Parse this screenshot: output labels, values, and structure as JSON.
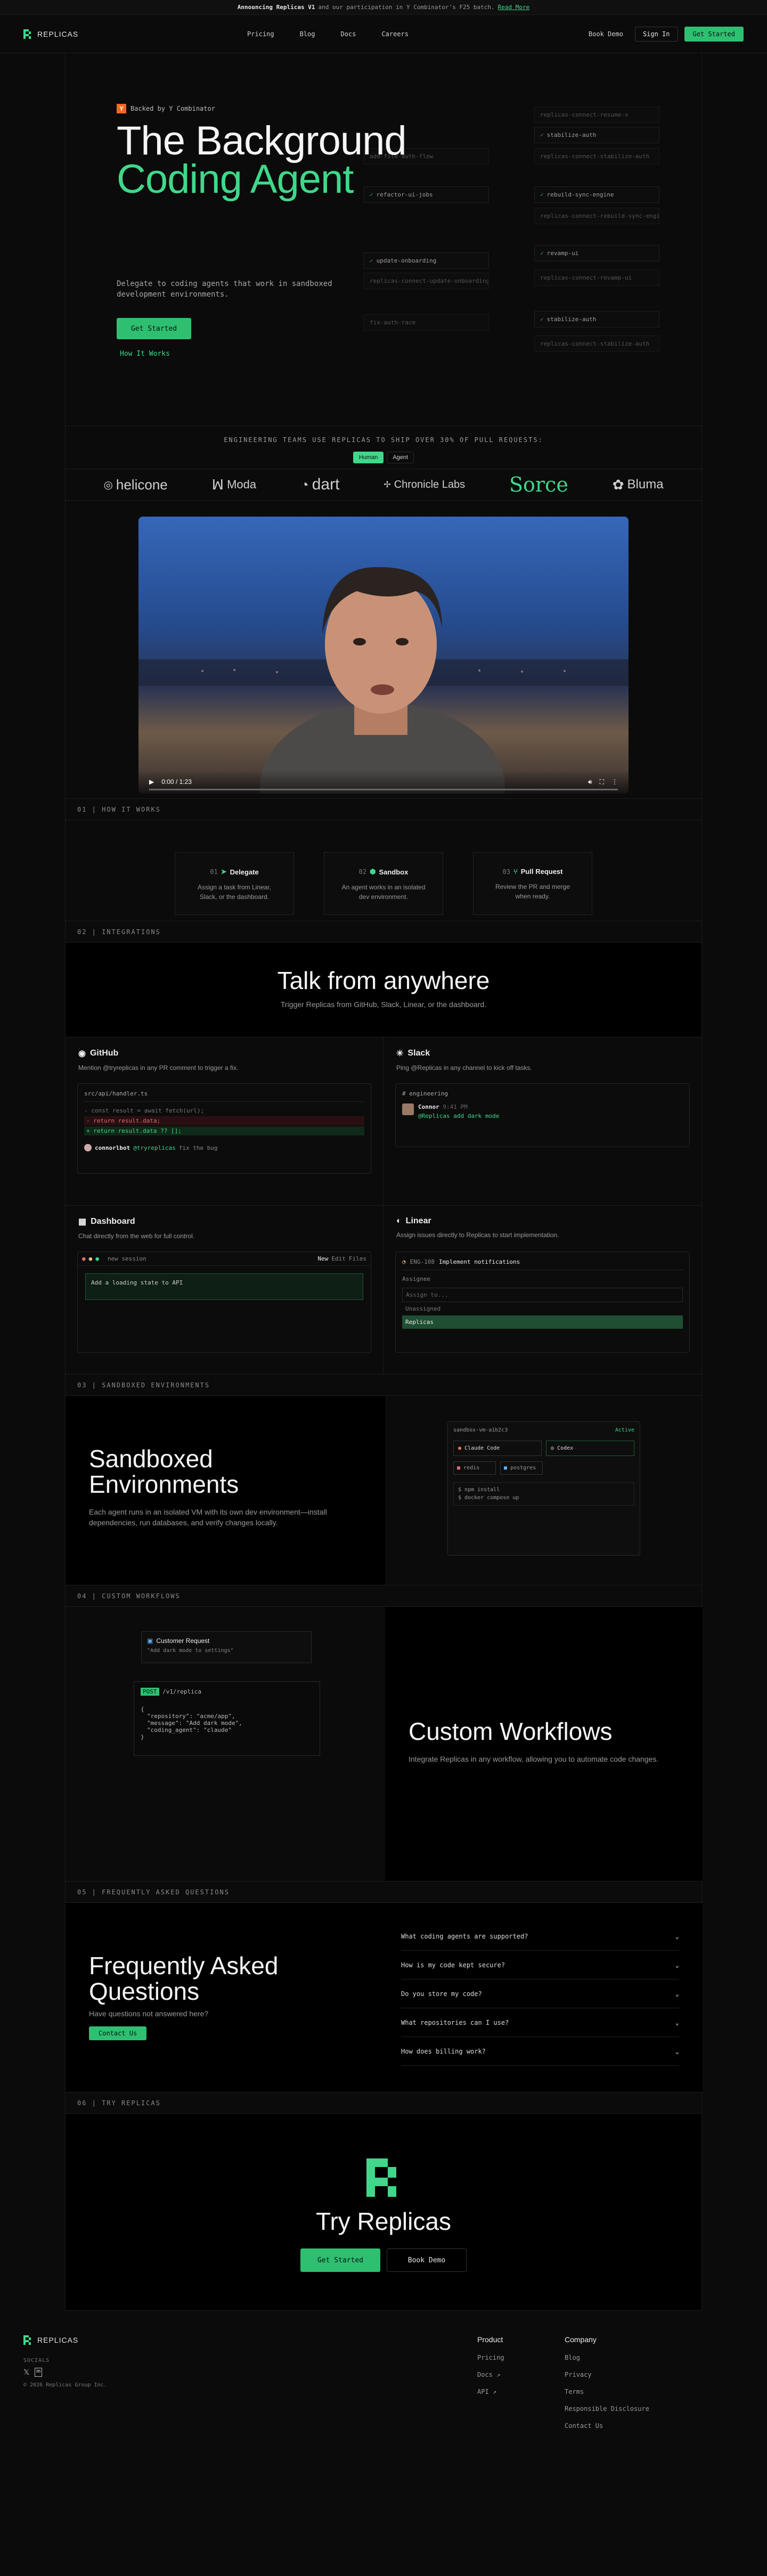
{
  "announce": {
    "prefix": "Announcing Replicas V1",
    "middle": "and our participation in Y Combinator's F25 batch.",
    "link": "Read More"
  },
  "nav": {
    "brand": "REPLICAS",
    "links": [
      "Pricing",
      "Blog",
      "Docs",
      "Careers"
    ],
    "book_demo": "Book Demo",
    "sign_in": "Sign In",
    "get_started": "Get Started"
  },
  "hero": {
    "backed": "Backed by Y Combinator",
    "yc": "Y",
    "title_1": "The Background",
    "title_2": "Coding Agent",
    "subtitle": "Delegate to coding agents that work in sandboxed development environments.",
    "cta": "Get Started",
    "how": "How It Works",
    "tasks": [
      "replicas-connect-resume-x",
      "stabilize-auth",
      "replicas-connect-stabilize-auth",
      "add-file-auth-flow",
      "refactor-ui-jobs",
      "rebuild-sync-engine",
      "replicas-connect-rebuild-sync-engine",
      "revamp-ui",
      "update-onboarding",
      "replicas-connect-revamp-ui",
      "replicas-connect-update-onboarding",
      "fix-auth-race",
      "stabilize-auth",
      "replicas-connect-stabilize-auth"
    ]
  },
  "logos": {
    "heading": "ENGINEERING TEAMS USE REPLICAS TO SHIP OVER 30% OF PULL REQUESTS:",
    "toggle_human": "Human",
    "toggle_agent": "Agent",
    "names": [
      "helicone",
      "Moda",
      "dart",
      "Chronicle Labs",
      "Sorce",
      "Bluma"
    ]
  },
  "video": {
    "time": "0:00 / 1:23"
  },
  "how": {
    "label": "01 | HOW IT WORKS",
    "steps": [
      {
        "n": "01",
        "title": "Delegate",
        "desc": "Assign a task from Linear, Slack, or the dashboard."
      },
      {
        "n": "02",
        "title": "Sandbox",
        "desc": "An agent works in an isolated dev environment."
      },
      {
        "n": "03",
        "title": "Pull Request",
        "desc": "Review the PR and merge when ready."
      }
    ]
  },
  "integrations": {
    "label": "02 | INTEGRATIONS",
    "title": "Talk from anywhere",
    "subtitle": "Trigger Replicas from GitHub, Slack, Linear, or the dashboard.",
    "github": {
      "title": "GitHub",
      "desc": "Mention @tryreplicas in any PR comment to trigger a fix.",
      "file": "src/api/handler.ts",
      "l1": "- const result = await fetch(url);",
      "l2": "- return result.data;",
      "l3": "+ return result.data ?? [];",
      "user": "connorlbot",
      "mention": "@tryreplicas",
      "msg": "fix the bug"
    },
    "slack": {
      "title": "Slack",
      "desc": "Ping @Replicas in any channel to kick off tasks.",
      "channel": "# engineering",
      "user": "Connor",
      "time": "9:41 PM",
      "msg": "@Replicas add dark mode"
    },
    "dashboard": {
      "title": "Dashboard",
      "desc": "Chat directly from the web for full control.",
      "tab": "new session",
      "action": "Add a loading state to API",
      "new": "New",
      "edit": "Edit",
      "files": "Files"
    },
    "linear": {
      "title": "Linear",
      "desc": "Assign issues directly to Replicas to start implementation.",
      "issue": "ENG-108",
      "issue_title": "Implement notifications",
      "assignee_label": "Assignee",
      "search": "Assign to...",
      "option1": "Unassigned",
      "option2": "Replicas"
    }
  },
  "sandbox": {
    "label": "03 | SANDBOXED ENVIRONMENTS",
    "title": "Sandboxed Environments",
    "desc": "Each agent runs in an isolated VM with its own dev environment—install dependencies, run databases, and verify changes locally.",
    "vm": "sandbox-vm-a1b2c3",
    "status": "Active",
    "agents": [
      "Claude Code",
      "Codex"
    ],
    "services": [
      "redis",
      "postgres"
    ],
    "cmd1": "npm install",
    "cmd2": "docker compose up"
  },
  "workflows": {
    "label": "04 | CUSTOM WORKFLOWS",
    "title": "Custom Workflows",
    "desc": "Integrate Replicas in any workflow, allowing you to automate code changes.",
    "req_title": "Customer Request",
    "req_body": "\"Add dark mode to settings\"",
    "method": "POST",
    "path": "/v1/replica",
    "json_1": "\"repository\": \"acme/app\",",
    "json_2": "\"message\": \"Add dark mode\",",
    "json_3": "\"coding_agent\": \"claude\""
  },
  "faq": {
    "label": "05 | FREQUENTLY ASKED QUESTIONS",
    "title": "Frequently Asked Questions",
    "subtitle": "Have questions not answered here?",
    "contact": "Contact Us",
    "questions": [
      "What coding agents are supported?",
      "How is my code kept secure?",
      "Do you store my code?",
      "What repositories can I use?",
      "How does billing work?"
    ]
  },
  "try": {
    "label": "06 | TRY REPLICAS",
    "title": "Try Replicas",
    "get_started": "Get Started",
    "book_demo": "Book Demo"
  },
  "footer": {
    "brand": "REPLICAS",
    "socials": "SOCIALS",
    "copyright": "© 2026 Replicas Group Inc.",
    "product_head": "Product",
    "product": [
      "Pricing",
      "Docs ↗",
      "API ↗"
    ],
    "company_head": "Company",
    "company": [
      "Blog",
      "Privacy",
      "Terms",
      "Responsible Disclosure",
      "Contact Us"
    ]
  },
  "colors": {
    "accent": "#3fd88a",
    "bg": "#0b0b0b",
    "yc": "#f26625"
  }
}
